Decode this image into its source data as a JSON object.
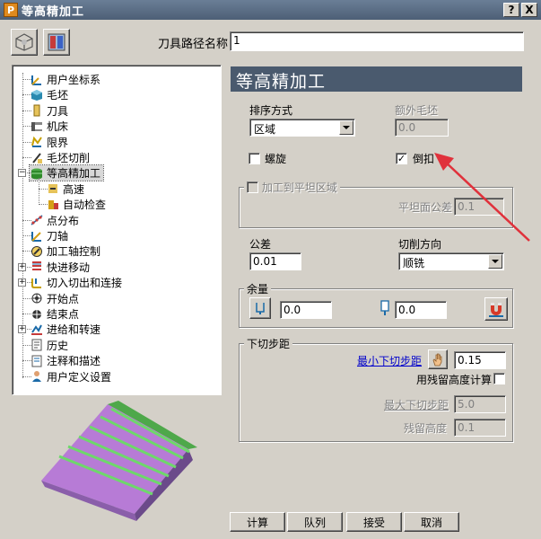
{
  "window": {
    "title": "等高精加工",
    "help_label": "?",
    "close_label": "X",
    "app_icon_letter": "P"
  },
  "header": {
    "toolpath_name_label": "刀具路径名称",
    "toolpath_name_value": "1"
  },
  "tree": {
    "items": [
      {
        "label": "用户坐标系",
        "icon": "user-coordinate-icon"
      },
      {
        "label": "毛坯",
        "icon": "block-icon"
      },
      {
        "label": "刀具",
        "icon": "tool-icon"
      },
      {
        "label": "机床",
        "icon": "machine-icon"
      },
      {
        "label": "限界",
        "icon": "boundary-icon"
      },
      {
        "label": "毛坯切削",
        "icon": "stock-cut-icon"
      },
      {
        "label": "等高精加工",
        "icon": "constant-z-icon"
      },
      {
        "label": "高速",
        "icon": "high-speed-icon"
      },
      {
        "label": "自动检查",
        "icon": "auto-check-icon"
      },
      {
        "label": "点分布",
        "icon": "point-distribution-icon"
      },
      {
        "label": "刀轴",
        "icon": "tool-axis-icon"
      },
      {
        "label": "加工轴控制",
        "icon": "axis-control-icon"
      },
      {
        "label": "快进移动",
        "icon": "rapid-move-icon"
      },
      {
        "label": "切入切出和连接",
        "icon": "lead-in-out-icon"
      },
      {
        "label": "开始点",
        "icon": "start-point-icon"
      },
      {
        "label": "结束点",
        "icon": "end-point-icon"
      },
      {
        "label": "进给和转速",
        "icon": "feed-speed-icon"
      },
      {
        "label": "历史",
        "icon": "history-icon"
      },
      {
        "label": "注释和描述",
        "icon": "notes-icon"
      },
      {
        "label": "用户定义设置",
        "icon": "user-settings-icon"
      }
    ]
  },
  "panel": {
    "title": "等高精加工",
    "order_label": "排序方式",
    "order_value": "区域",
    "extra_stock_label": "额外毛坯",
    "extra_stock_value": "0.0",
    "spiral_label": "螺旋",
    "undercut_label": "倒扣",
    "flat_group_label": "加工到平坦区域",
    "flat_tolerance_label": "平坦面公差",
    "flat_tolerance_value": "0.1",
    "tolerance_label": "公差",
    "tolerance_value": "0.01",
    "cut_direction_label": "切削方向",
    "cut_direction_value": "顺铣",
    "allowance_group_label": "余量",
    "radial_allowance_value": "0.0",
    "axial_allowance_value": "0.0",
    "stepdown_group_label": "下切步距",
    "min_stepdown_label": "最小下切步距",
    "min_stepdown_value": "0.15",
    "scallop_calc_label": "用残留高度计算",
    "max_stepdown_label": "最大下切步距",
    "max_stepdown_value": "5.0",
    "scallop_height_label": "残留高度",
    "scallop_height_value": "0.1"
  },
  "buttons": {
    "calculate": "计算",
    "queue": "队列",
    "accept": "接受",
    "cancel": "取消"
  },
  "annotation": {
    "arrow_color": "#e0313b"
  },
  "colors": {
    "panel_header": "#4a5a6e",
    "title_bar": "#56687f"
  }
}
